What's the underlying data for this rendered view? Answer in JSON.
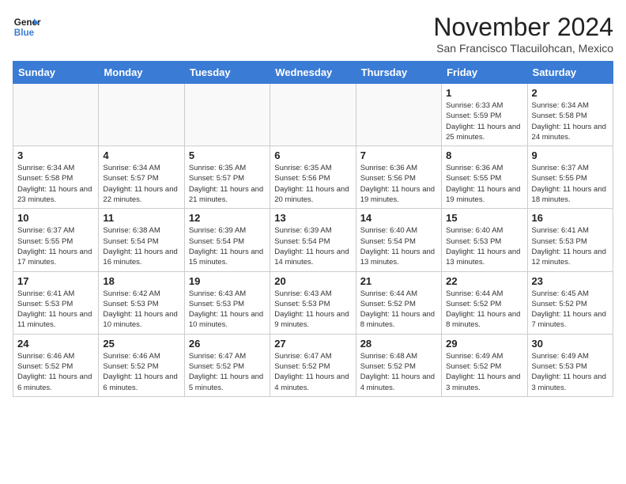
{
  "logo": {
    "line1": "General",
    "line2": "Blue"
  },
  "title": "November 2024",
  "subtitle": "San Francisco Tlacuilohcan, Mexico",
  "headers": [
    "Sunday",
    "Monday",
    "Tuesday",
    "Wednesday",
    "Thursday",
    "Friday",
    "Saturday"
  ],
  "weeks": [
    [
      {
        "day": "",
        "info": ""
      },
      {
        "day": "",
        "info": ""
      },
      {
        "day": "",
        "info": ""
      },
      {
        "day": "",
        "info": ""
      },
      {
        "day": "",
        "info": ""
      },
      {
        "day": "1",
        "info": "Sunrise: 6:33 AM\nSunset: 5:59 PM\nDaylight: 11 hours and 25 minutes."
      },
      {
        "day": "2",
        "info": "Sunrise: 6:34 AM\nSunset: 5:58 PM\nDaylight: 11 hours and 24 minutes."
      }
    ],
    [
      {
        "day": "3",
        "info": "Sunrise: 6:34 AM\nSunset: 5:58 PM\nDaylight: 11 hours and 23 minutes."
      },
      {
        "day": "4",
        "info": "Sunrise: 6:34 AM\nSunset: 5:57 PM\nDaylight: 11 hours and 22 minutes."
      },
      {
        "day": "5",
        "info": "Sunrise: 6:35 AM\nSunset: 5:57 PM\nDaylight: 11 hours and 21 minutes."
      },
      {
        "day": "6",
        "info": "Sunrise: 6:35 AM\nSunset: 5:56 PM\nDaylight: 11 hours and 20 minutes."
      },
      {
        "day": "7",
        "info": "Sunrise: 6:36 AM\nSunset: 5:56 PM\nDaylight: 11 hours and 19 minutes."
      },
      {
        "day": "8",
        "info": "Sunrise: 6:36 AM\nSunset: 5:55 PM\nDaylight: 11 hours and 19 minutes."
      },
      {
        "day": "9",
        "info": "Sunrise: 6:37 AM\nSunset: 5:55 PM\nDaylight: 11 hours and 18 minutes."
      }
    ],
    [
      {
        "day": "10",
        "info": "Sunrise: 6:37 AM\nSunset: 5:55 PM\nDaylight: 11 hours and 17 minutes."
      },
      {
        "day": "11",
        "info": "Sunrise: 6:38 AM\nSunset: 5:54 PM\nDaylight: 11 hours and 16 minutes."
      },
      {
        "day": "12",
        "info": "Sunrise: 6:39 AM\nSunset: 5:54 PM\nDaylight: 11 hours and 15 minutes."
      },
      {
        "day": "13",
        "info": "Sunrise: 6:39 AM\nSunset: 5:54 PM\nDaylight: 11 hours and 14 minutes."
      },
      {
        "day": "14",
        "info": "Sunrise: 6:40 AM\nSunset: 5:54 PM\nDaylight: 11 hours and 13 minutes."
      },
      {
        "day": "15",
        "info": "Sunrise: 6:40 AM\nSunset: 5:53 PM\nDaylight: 11 hours and 13 minutes."
      },
      {
        "day": "16",
        "info": "Sunrise: 6:41 AM\nSunset: 5:53 PM\nDaylight: 11 hours and 12 minutes."
      }
    ],
    [
      {
        "day": "17",
        "info": "Sunrise: 6:41 AM\nSunset: 5:53 PM\nDaylight: 11 hours and 11 minutes."
      },
      {
        "day": "18",
        "info": "Sunrise: 6:42 AM\nSunset: 5:53 PM\nDaylight: 11 hours and 10 minutes."
      },
      {
        "day": "19",
        "info": "Sunrise: 6:43 AM\nSunset: 5:53 PM\nDaylight: 11 hours and 10 minutes."
      },
      {
        "day": "20",
        "info": "Sunrise: 6:43 AM\nSunset: 5:53 PM\nDaylight: 11 hours and 9 minutes."
      },
      {
        "day": "21",
        "info": "Sunrise: 6:44 AM\nSunset: 5:52 PM\nDaylight: 11 hours and 8 minutes."
      },
      {
        "day": "22",
        "info": "Sunrise: 6:44 AM\nSunset: 5:52 PM\nDaylight: 11 hours and 8 minutes."
      },
      {
        "day": "23",
        "info": "Sunrise: 6:45 AM\nSunset: 5:52 PM\nDaylight: 11 hours and 7 minutes."
      }
    ],
    [
      {
        "day": "24",
        "info": "Sunrise: 6:46 AM\nSunset: 5:52 PM\nDaylight: 11 hours and 6 minutes."
      },
      {
        "day": "25",
        "info": "Sunrise: 6:46 AM\nSunset: 5:52 PM\nDaylight: 11 hours and 6 minutes."
      },
      {
        "day": "26",
        "info": "Sunrise: 6:47 AM\nSunset: 5:52 PM\nDaylight: 11 hours and 5 minutes."
      },
      {
        "day": "27",
        "info": "Sunrise: 6:47 AM\nSunset: 5:52 PM\nDaylight: 11 hours and 4 minutes."
      },
      {
        "day": "28",
        "info": "Sunrise: 6:48 AM\nSunset: 5:52 PM\nDaylight: 11 hours and 4 minutes."
      },
      {
        "day": "29",
        "info": "Sunrise: 6:49 AM\nSunset: 5:52 PM\nDaylight: 11 hours and 3 minutes."
      },
      {
        "day": "30",
        "info": "Sunrise: 6:49 AM\nSunset: 5:53 PM\nDaylight: 11 hours and 3 minutes."
      }
    ]
  ]
}
